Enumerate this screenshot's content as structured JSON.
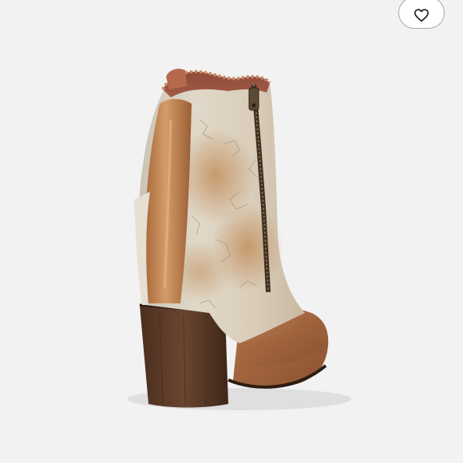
{
  "product": {
    "image_subject": "ankle-boot",
    "colors": {
      "background": "#f2f2f2",
      "leather_tan": "#b87a4a",
      "distressed_cream": "#d8cfbf",
      "heel_wood": "#5a3a26",
      "zipper": "#4a3a2a"
    }
  },
  "favorite_button": {
    "icon": "heart-outline-icon"
  }
}
